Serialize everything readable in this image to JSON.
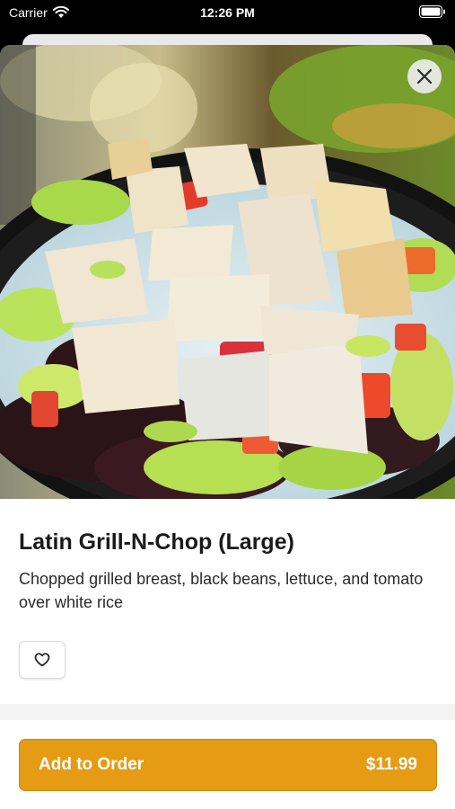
{
  "status_bar": {
    "carrier": "Carrier",
    "time": "12:26 PM",
    "wifi_icon": "wifi-icon",
    "battery_icon": "battery-icon"
  },
  "hero": {
    "close_icon": "close-icon"
  },
  "item": {
    "title": "Latin Grill-N-Chop (Large)",
    "description": "Chopped grilled breast, black beans, lettuce, and tomato over white rice",
    "favorite_icon": "heart-icon"
  },
  "footer": {
    "add_label": "Add to Order",
    "price": "$11.99"
  },
  "colors": {
    "accent": "#e59b14",
    "accent_border": "#c98510"
  }
}
